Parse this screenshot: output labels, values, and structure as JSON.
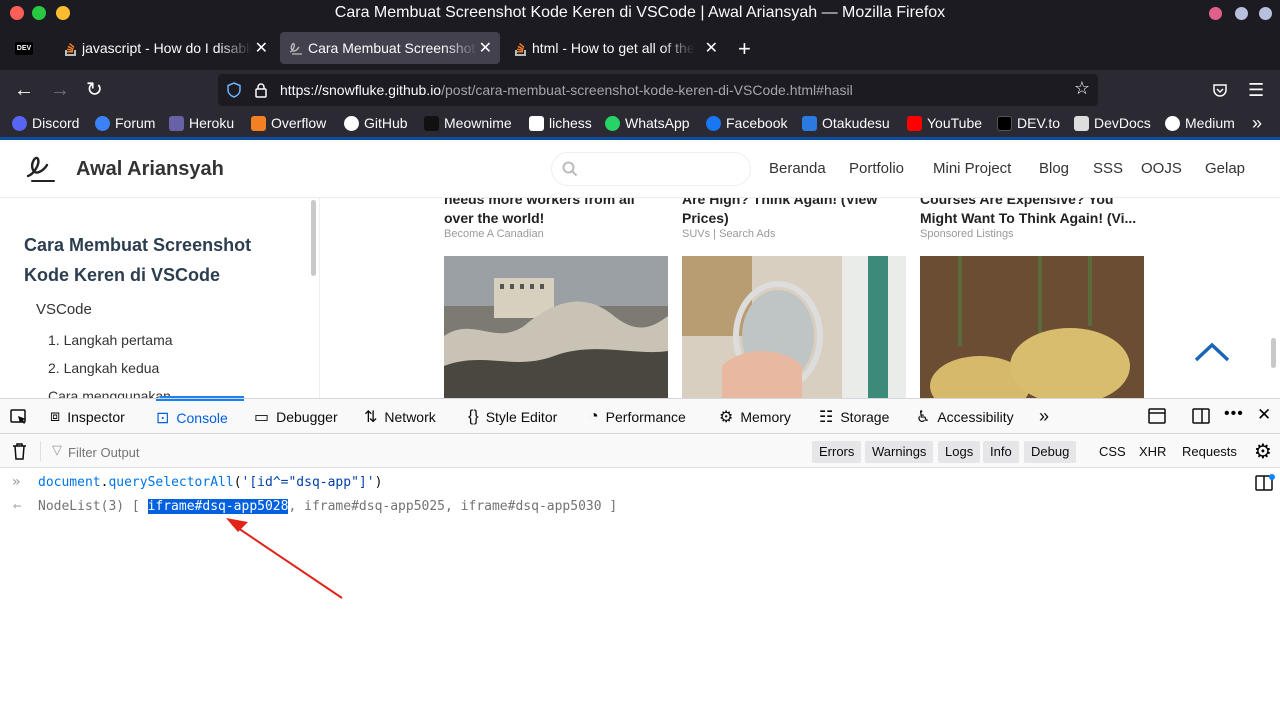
{
  "window": {
    "title": "Cara Membuat Screenshot Kode Keren di VSCode | Awal Ariansyah — Mozilla Firefox"
  },
  "tabs": [
    {
      "label": "javascript - How do I disable"
    },
    {
      "label": "Cara Membuat Screenshot Kode"
    },
    {
      "label": "html - How to get all of the"
    }
  ],
  "pinned_tab": {
    "label": "DEV"
  },
  "url": {
    "host": "https://snowfluke.github.io",
    "path": "/post/cara-membuat-screenshot-kode-keren-di-VSCode.html#hasil"
  },
  "bookmarks": [
    {
      "label": "Discord",
      "color": "#5865f2"
    },
    {
      "label": "Forum",
      "color": "#3b82f6"
    },
    {
      "label": "Heroku",
      "color": "#6762a6"
    },
    {
      "label": "Overflow",
      "color": "#f48024"
    },
    {
      "label": "GitHub",
      "color": "#ffffff"
    },
    {
      "label": "Meownime",
      "color": "#222222"
    },
    {
      "label": "lichess",
      "color": "#ffffff"
    },
    {
      "label": "WhatsApp",
      "color": "#25d366"
    },
    {
      "label": "Facebook",
      "color": "#1877f2"
    },
    {
      "label": "Otakudesu",
      "color": "#2a7ae2"
    },
    {
      "label": "YouTube",
      "color": "#ff0000"
    },
    {
      "label": "DEV.to",
      "color": "#000000"
    },
    {
      "label": "DevDocs",
      "color": "#dddddd"
    },
    {
      "label": "Medium",
      "color": "#000000"
    }
  ],
  "site": {
    "title": "Awal Ariansyah",
    "nav": [
      "Beranda",
      "Portfolio",
      "Mini Project",
      "Blog",
      "SSS",
      "OOJS",
      "Gelap"
    ]
  },
  "sidebar": {
    "title": "Cara Membuat Screenshot Kode Keren di VSCode",
    "items": [
      "VSCode",
      "1. Langkah pertama",
      "2. Langkah kedua",
      "Cara menggunakan"
    ]
  },
  "ads": [
    {
      "title": "needs more workers from all over the world!",
      "source": "Become A Canadian"
    },
    {
      "title": "Are High? Think Again! (View Prices)",
      "source": "SUVs | Search Ads"
    },
    {
      "title": "Courses Are Expensive? You Might Want To Think Again! (Vi...",
      "source": "Sponsored Listings"
    }
  ],
  "devtools": {
    "tabs": [
      {
        "label": "Inspector",
        "icon": "inspector-icon"
      },
      {
        "label": "Console",
        "icon": "console-icon"
      },
      {
        "label": "Debugger",
        "icon": "debugger-icon"
      },
      {
        "label": "Network",
        "icon": "network-icon"
      },
      {
        "label": "Style Editor",
        "icon": "style-editor-icon"
      },
      {
        "label": "Performance",
        "icon": "performance-icon"
      },
      {
        "label": "Memory",
        "icon": "memory-icon"
      },
      {
        "label": "Storage",
        "icon": "storage-icon"
      },
      {
        "label": "Accessibility",
        "icon": "accessibility-icon"
      }
    ],
    "active_tab": "Console",
    "filter_placeholder": "Filter Output",
    "levels": [
      "Errors",
      "Warnings",
      "Logs",
      "Info",
      "Debug"
    ],
    "types": [
      "CSS",
      "XHR",
      "Requests"
    ]
  },
  "console": {
    "input": {
      "object": "document",
      "method": "querySelectorAll",
      "arg": "'[id^=\"dsq-app\"]'"
    },
    "output": {
      "prefix": "NodeList(3)",
      "items": [
        "iframe#dsq-app5028",
        "iframe#dsq-app5025",
        "iframe#dsq-app5030"
      ]
    }
  }
}
